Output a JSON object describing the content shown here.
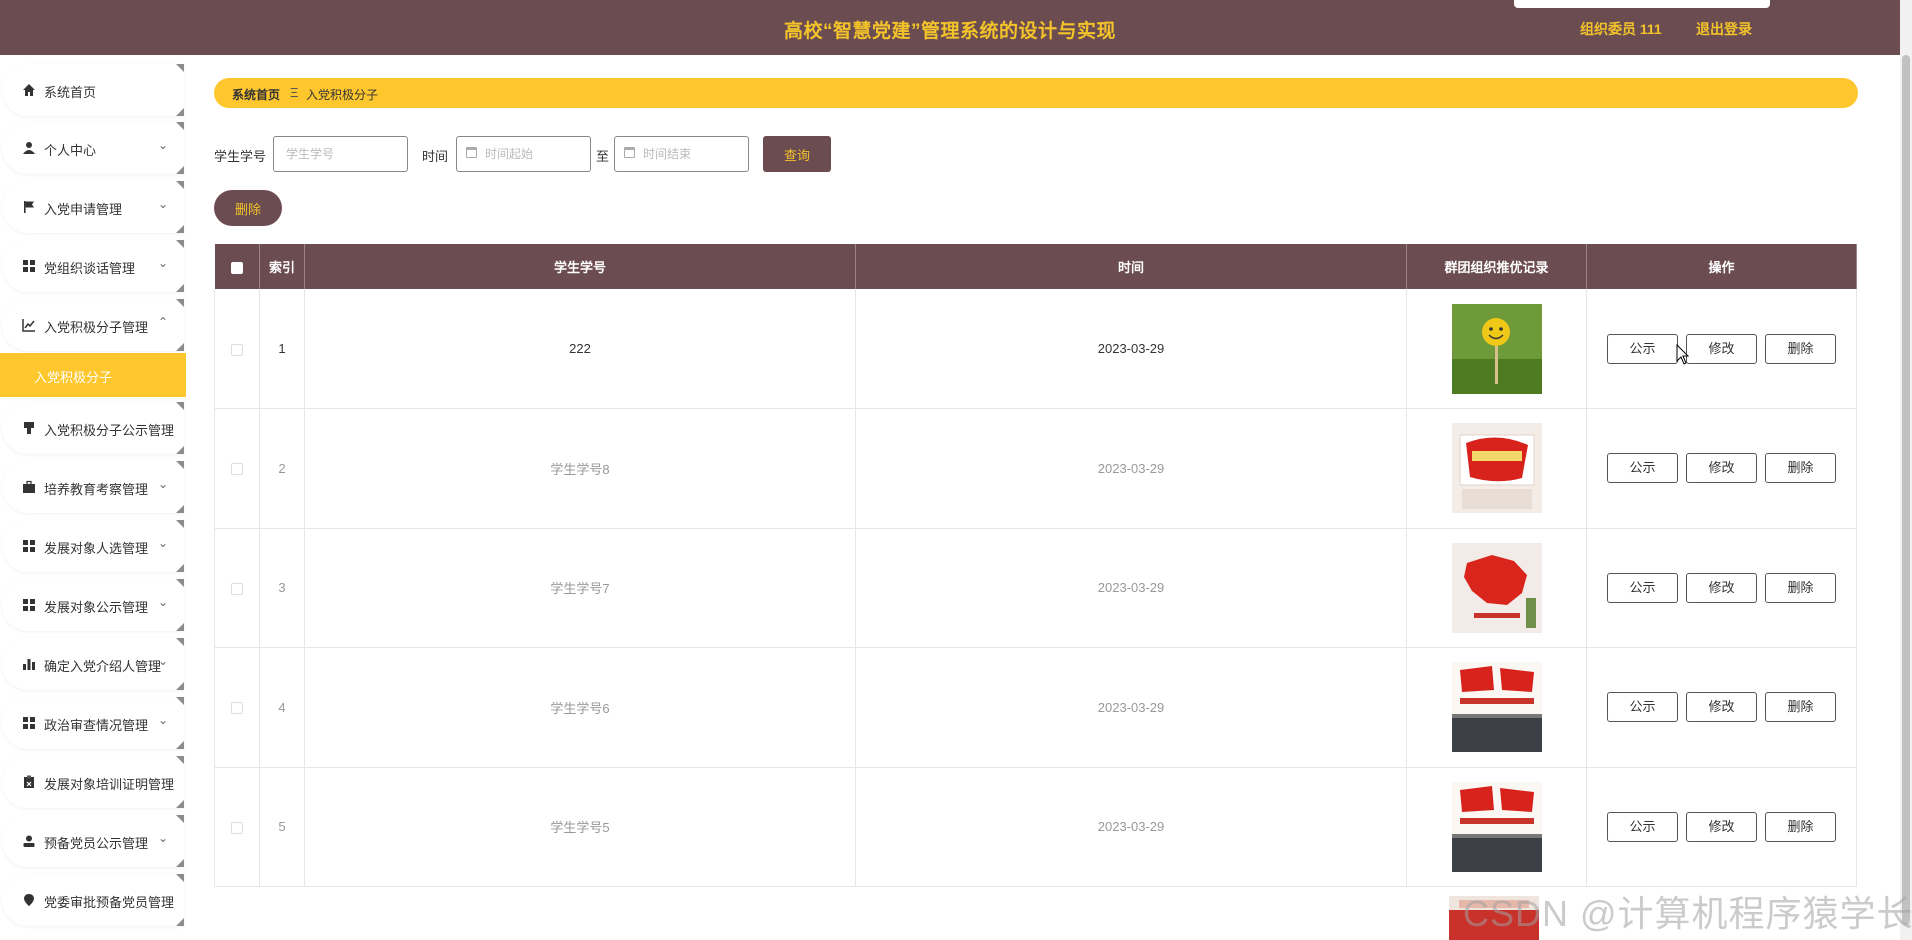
{
  "header": {
    "title": "高校“智慧党建”管理系统的设计与实现",
    "user": "组织委员 111",
    "logout": "退出登录"
  },
  "sidebar": {
    "items": [
      {
        "label": "系统首页",
        "icon": "home-icon",
        "chevron": ""
      },
      {
        "label": "个人中心",
        "icon": "user-icon",
        "chevron": "⌄"
      },
      {
        "label": "入党申请管理",
        "icon": "flag-icon",
        "chevron": "⌄"
      },
      {
        "label": "党组织谈话管理",
        "icon": "grid-icon",
        "chevron": "⌄"
      },
      {
        "label": "入党积极分子管理",
        "icon": "chart-line-icon",
        "chevron": "⌃"
      },
      {
        "label": "入党积极分子公示管理",
        "icon": "stamp-icon",
        "chevron": ""
      },
      {
        "label": "培养教育考察管理",
        "icon": "briefcase-icon",
        "chevron": "⌄"
      },
      {
        "label": "发展对象人选管理",
        "icon": "grid-icon",
        "chevron": "⌄"
      },
      {
        "label": "发展对象公示管理",
        "icon": "grid-icon",
        "chevron": "⌄"
      },
      {
        "label": "确定入党介绍人管理",
        "icon": "bar-chart-icon",
        "chevron": "⌄"
      },
      {
        "label": "政治审查情况管理",
        "icon": "grid-icon",
        "chevron": "⌄"
      },
      {
        "label": "发展对象培训证明管理",
        "icon": "clipboard-icon",
        "chevron": ""
      },
      {
        "label": "预备党员公示管理",
        "icon": "person-icon",
        "chevron": "⌄"
      },
      {
        "label": "党委审批预备党员管理",
        "icon": "location-icon",
        "chevron": ""
      }
    ],
    "active_sub": "入党积极分子"
  },
  "breadcrumb": {
    "home": "系统首页",
    "sep": "Ξ",
    "current": "入党积极分子"
  },
  "search": {
    "student_label": "学生学号",
    "student_placeholder": "学生学号",
    "time_label": "时间",
    "start_placeholder": "时间起始",
    "to_label": "至",
    "end_placeholder": "时间结束",
    "query_label": "查询"
  },
  "toolbar": {
    "delete_label": "删除"
  },
  "table": {
    "headers": [
      "",
      "索引",
      "学生学号",
      "时间",
      "群团组织推优记录",
      "操作"
    ],
    "rows": [
      {
        "index": "1",
        "student": "222",
        "time": "2023-03-29"
      },
      {
        "index": "2",
        "student": "学生学号8",
        "time": "2023-03-29"
      },
      {
        "index": "3",
        "student": "学生学号7",
        "time": "2023-03-29"
      },
      {
        "index": "4",
        "student": "学生学号6",
        "time": "2023-03-29"
      },
      {
        "index": "5",
        "student": "学生学号5",
        "time": "2023-03-29"
      }
    ],
    "actions": {
      "publicize": "公示",
      "edit": "修改",
      "delete": "删除"
    }
  },
  "watermark": "CSDN @计算机程序猿学长",
  "colors": {
    "header_bg": "#6b4c51",
    "accent_yellow": "#fec72e",
    "title_gold": "#f3c32a"
  }
}
